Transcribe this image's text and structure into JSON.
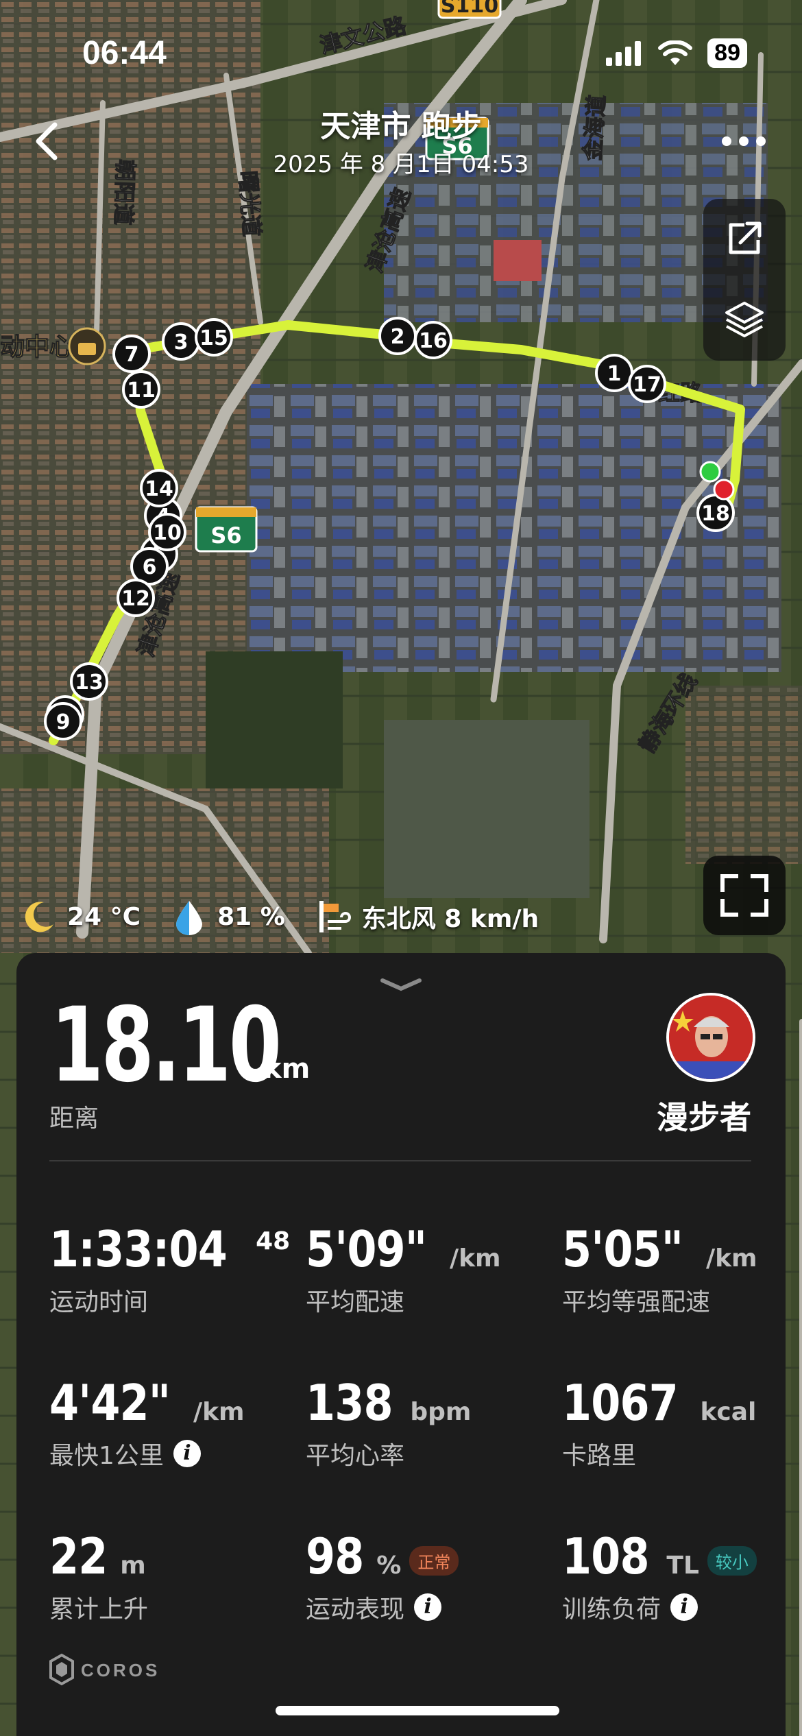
{
  "status_bar": {
    "time": "06:44",
    "battery": "89"
  },
  "header": {
    "title": "天津市 跑步",
    "subtitle": "2025 年 8 月1日 04:53"
  },
  "map": {
    "road_labels": {
      "jinwen": "津文公路",
      "chaoyang": "朝阳道",
      "shuguang": "曙光道",
      "jincang1": "津沧高速",
      "jincang2": "津沧高速",
      "jinhai": "金海道",
      "jinghai_ring": "静海环线",
      "hong": "红路",
      "center": "动中心",
      "s110": "S110",
      "s6a": "S6",
      "s6b": "S6"
    },
    "km_markers": [
      "1",
      "2",
      "3",
      "4",
      "5",
      "6",
      "7",
      "8",
      "9",
      "10",
      "11",
      "12",
      "13",
      "14",
      "15",
      "16",
      "17",
      "18"
    ]
  },
  "weather": {
    "temp": "24 °C",
    "humidity": "81 %",
    "wind": "东北风 8 km/h"
  },
  "summary": {
    "distance": "18.10",
    "distance_unit": "km",
    "distance_label": "距离",
    "username": "漫步者"
  },
  "stats": [
    {
      "value": "1:33:04",
      "sup": "48",
      "unit": "",
      "label": "运动时间"
    },
    {
      "value": "5'09\"",
      "unit": "/km",
      "label": "平均配速"
    },
    {
      "value": "5'05\"",
      "unit": "/km",
      "label": "平均等强配速"
    },
    {
      "value": "4'42\"",
      "unit": "/km",
      "label": "最快1公里"
    },
    {
      "value": "138",
      "unit": "bpm",
      "label": "平均心率"
    },
    {
      "value": "1067",
      "unit": "kcal",
      "label": "卡路里"
    },
    {
      "value": "22",
      "unit": "m",
      "label": "累计上升"
    },
    {
      "value": "98",
      "unit": "%",
      "label": "运动表现",
      "badge": "正常"
    },
    {
      "value": "108",
      "unit": "TL",
      "label": "训练负荷",
      "badge": "较小"
    }
  ],
  "brand": "COROS",
  "colors": {
    "route": "#d8f23a",
    "panel": "#1c1c1c",
    "start": "#2ecc40",
    "end": "#e0222b"
  }
}
